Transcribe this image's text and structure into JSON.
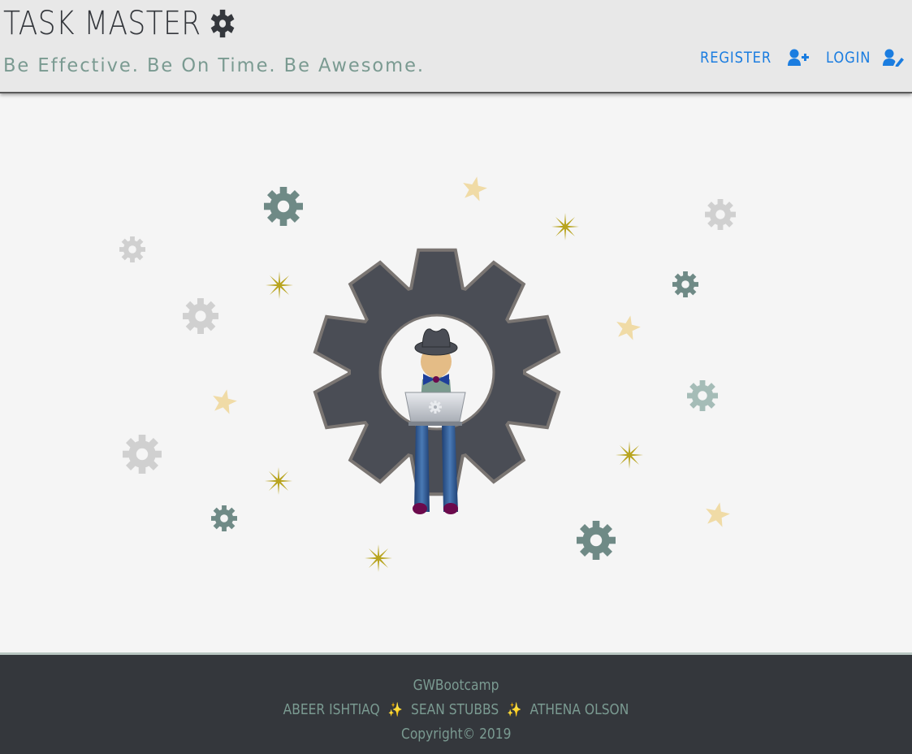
{
  "header": {
    "title": "TASK MASTER",
    "tagline": "Be Effective. Be On Time. Be Awesome.",
    "title_icon": "gear-icon"
  },
  "nav": {
    "register_label": "REGISTER",
    "register_icon": "user-plus-icon",
    "login_label": "LOGIN",
    "login_icon": "user-edit-icon"
  },
  "hero": {
    "illustration": "person-with-laptop-in-gear"
  },
  "footer": {
    "org": "GWBootcamp",
    "authors": [
      "ABEER ISHTIAQ",
      "SEAN STUBBS",
      "ATHENA OLSON"
    ],
    "separator_icon": "sparkles-icon",
    "copyright": "Copyright© 2019"
  },
  "colors": {
    "header_bg": "#e8e8e8",
    "title": "#34373c",
    "tagline": "#7a9a91",
    "link": "#1b7de0",
    "footer_bg": "#34373c",
    "gear_dark": "#4a4d55",
    "gear_green": "#6f8a86",
    "gear_light": "#d0d0d0",
    "gear_mint": "#a5bcb7",
    "star_gold": "#b8a41f",
    "star_cream": "#f0dba6"
  }
}
